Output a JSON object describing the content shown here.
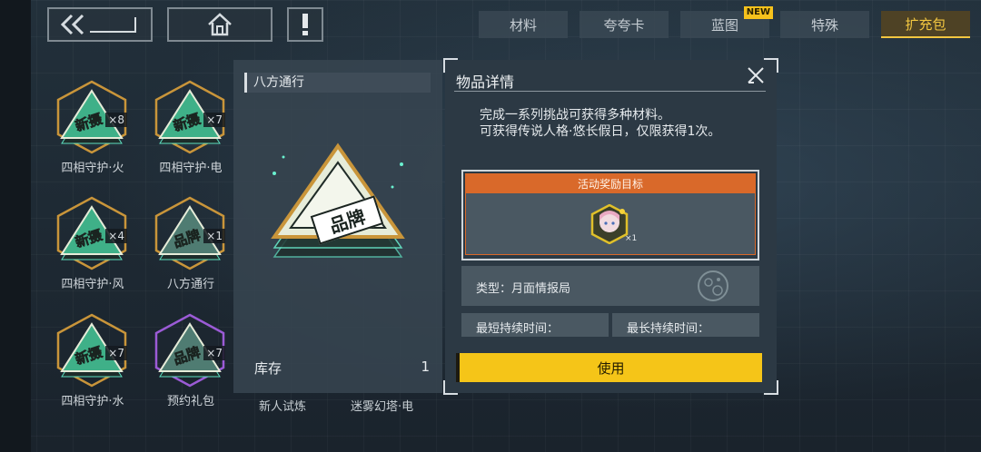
{
  "nav": {
    "back_icon": "back-arrow-icon",
    "home_icon": "home-icon",
    "alert_icon": "exclamation-icon"
  },
  "tabs": [
    {
      "label": "材料",
      "active": false
    },
    {
      "label": "夸夸卡",
      "active": false
    },
    {
      "label": "蓝图",
      "active": false,
      "badge": "NEW"
    },
    {
      "label": "特殊",
      "active": false
    },
    {
      "label": "扩充包",
      "active": true
    }
  ],
  "items": [
    {
      "name": "四相守护·火",
      "count": "×8",
      "stamp": "新摄"
    },
    {
      "name": "四相守护·电",
      "count": "×7",
      "stamp": "新摄"
    },
    {
      "name": "四相守护·风",
      "count": "×4",
      "stamp": "新摄"
    },
    {
      "name": "八方通行",
      "count": "×1",
      "stamp": "品牌"
    },
    {
      "name": "四相守护·水",
      "count": "×7",
      "stamp": "新摄"
    },
    {
      "name": "预约礼包",
      "count": "×7",
      "stamp": "品牌"
    }
  ],
  "under_preview_names": [
    "新人试炼",
    "迷雾幻塔·电"
  ],
  "preview": {
    "title": "八方通行",
    "stamp": "品牌",
    "stock_label": "库存",
    "stock_value": "1"
  },
  "detail": {
    "title": "物品详情",
    "description": "完成一系列挑战可获得多种材料。\n可获得传说人格·悠长假日，仅限获得1次。",
    "reward_header": "活动奖励目标",
    "reward_qty": "×1",
    "type_text": "类型：月面情报局",
    "min_duration_label": "最短持续时间：",
    "max_duration_label": "最长持续时间：",
    "use_label": "使用"
  },
  "colors": {
    "accent_gold": "#f5c518",
    "reward_orange": "#d9692a",
    "green_item": "#3fb088",
    "purple_frame": "#9b5bd6",
    "gold_frame": "#c9953a"
  }
}
